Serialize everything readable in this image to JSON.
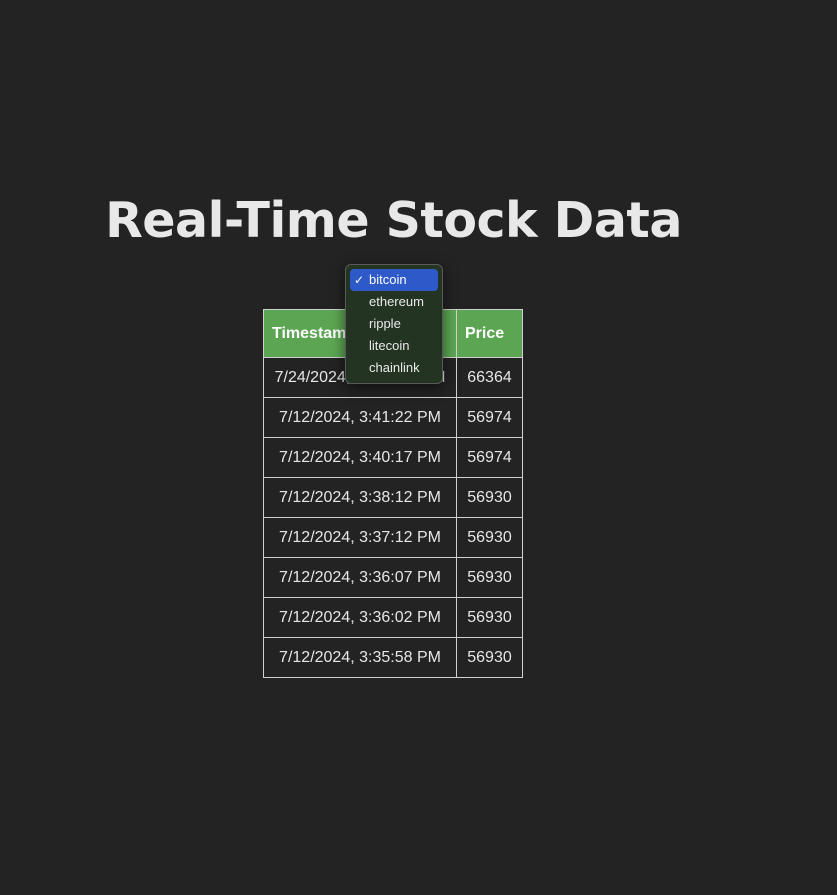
{
  "page": {
    "title": "Real-Time Stock Data"
  },
  "dropdown": {
    "options": [
      "bitcoin",
      "ethereum",
      "ripple",
      "litecoin",
      "chainlink"
    ],
    "selected": "bitcoin"
  },
  "table": {
    "headers": [
      "Timestamp",
      "Price"
    ],
    "rows": [
      [
        "7/24/2024, 10:53:50 PM",
        "66364"
      ],
      [
        "7/12/2024, 3:41:22 PM",
        "56974"
      ],
      [
        "7/12/2024, 3:40:17 PM",
        "56974"
      ],
      [
        "7/12/2024, 3:38:12 PM",
        "56930"
      ],
      [
        "7/12/2024, 3:37:12 PM",
        "56930"
      ],
      [
        "7/12/2024, 3:36:07 PM",
        "56930"
      ],
      [
        "7/12/2024, 3:36:02 PM",
        "56930"
      ],
      [
        "7/12/2024, 3:35:58 PM",
        "56930"
      ]
    ]
  },
  "colors": {
    "background": "#232323",
    "header_green": "#5ca653",
    "selected_blue": "#2d5ac8"
  }
}
